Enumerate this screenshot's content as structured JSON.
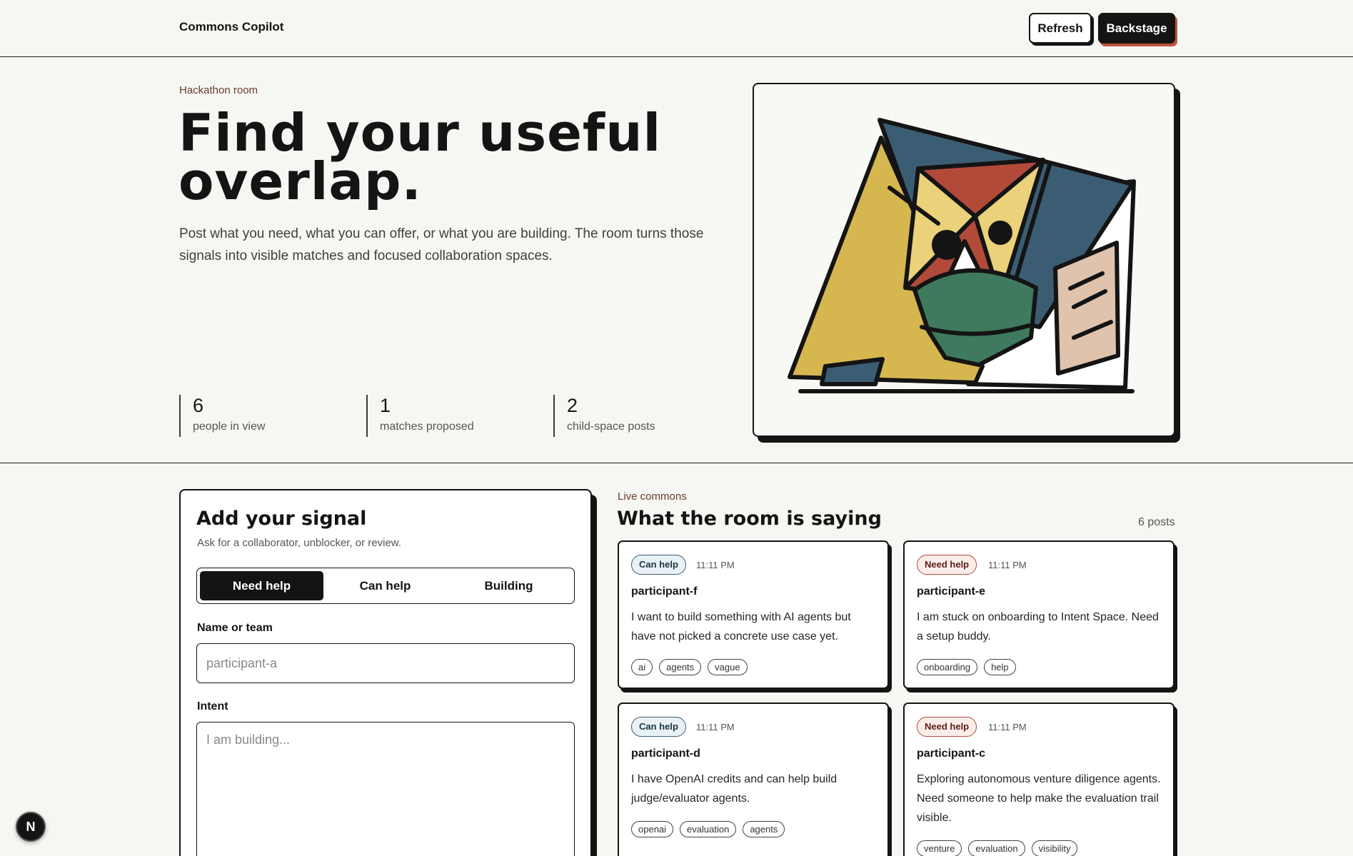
{
  "header": {
    "brand": "Commons Copilot",
    "refresh_label": "Refresh",
    "backstage_label": "Backstage"
  },
  "hero": {
    "eyebrow": "Hackathon room",
    "title_line1": "Find your useful",
    "title_line2": "overlap.",
    "subtitle": "Post what you need, what you can offer, or what you are building. The room turns those signals into visible matches and focused collaboration spaces.",
    "stats": [
      {
        "value": "6",
        "label": "people in view"
      },
      {
        "value": "1",
        "label": "matches proposed"
      },
      {
        "value": "2",
        "label": "child-space posts"
      }
    ]
  },
  "form": {
    "title": "Add your signal",
    "subtitle": "Ask for a collaborator, unblocker, or review.",
    "modes": [
      "Need help",
      "Can help",
      "Building"
    ],
    "active_mode": "Need help",
    "name_label": "Name or team",
    "name_placeholder": "participant-a",
    "intent_label": "Intent",
    "intent_placeholder": "I am building..."
  },
  "live": {
    "eyebrow": "Live commons",
    "title": "What the room is saying",
    "count": "6 posts",
    "posts": [
      {
        "badge": "Can help",
        "kind": "can",
        "time": "11:11 PM",
        "author": "participant-f",
        "body": "I want to build something with AI agents but have not picked a concrete use case yet.",
        "tags": [
          "ai",
          "agents",
          "vague"
        ]
      },
      {
        "badge": "Need help",
        "kind": "need",
        "time": "11:11 PM",
        "author": "participant-e",
        "body": "I am stuck on onboarding to Intent Space. Need a setup buddy.",
        "tags": [
          "onboarding",
          "help"
        ]
      },
      {
        "badge": "Can help",
        "kind": "can",
        "time": "11:11 PM",
        "author": "participant-d",
        "body": "I have OpenAI credits and can help build judge/evaluator agents.",
        "tags": [
          "openai",
          "evaluation",
          "agents"
        ]
      },
      {
        "badge": "Need help",
        "kind": "need",
        "time": "11:11 PM",
        "author": "participant-c",
        "body": "Exploring autonomous venture diligence agents. Need someone to help make the evaluation trail visible.",
        "tags": [
          "venture",
          "evaluation",
          "visibility"
        ]
      }
    ]
  },
  "dev_badge": "N",
  "colors": {
    "background": "#f6f6f2",
    "ink": "#141414",
    "accent_red": "#c0533f",
    "art_yellow": "#d6b64f",
    "art_blue": "#3b5d74",
    "art_red": "#b24a3a",
    "art_green": "#3f7a5e",
    "art_peach": "#dfc3ad"
  }
}
